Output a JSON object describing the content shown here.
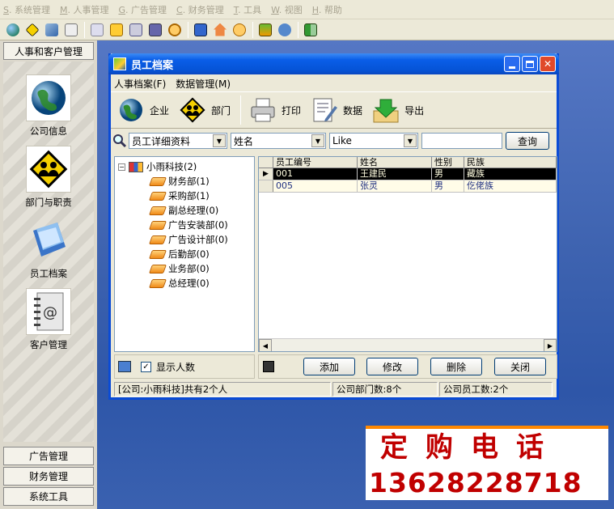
{
  "menubar": [
    {
      "key": "S",
      "label": "系统管理"
    },
    {
      "key": "M",
      "label": "人事管理"
    },
    {
      "key": "G",
      "label": "广告管理"
    },
    {
      "key": "C",
      "label": "财务管理"
    },
    {
      "key": "T",
      "label": "工具"
    },
    {
      "key": "W",
      "label": "视图"
    },
    {
      "key": "H",
      "label": "帮助"
    }
  ],
  "sidebar": {
    "header": "人事和客户管理",
    "items": [
      {
        "label": "公司信息",
        "icon": "globe-icon"
      },
      {
        "label": "部门与职责",
        "icon": "people-sign-icon"
      },
      {
        "label": "员工档案",
        "icon": "documents-icon"
      },
      {
        "label": "客户管理",
        "icon": "address-book-icon"
      }
    ],
    "bottom_buttons": [
      "广告管理",
      "财务管理",
      "系统工具"
    ]
  },
  "ad": {
    "line1": "定购电话",
    "line2": "13628228718"
  },
  "window": {
    "title": "员工档案",
    "menu": [
      "人事档案(F)",
      "数据管理(M)"
    ],
    "tools": [
      {
        "label": "企业",
        "icon": "globe-icon"
      },
      {
        "label": "部门",
        "icon": "people-sign-icon"
      },
      {
        "label": "打印",
        "icon": "printer-icon"
      },
      {
        "label": "数据",
        "icon": "document-pen-icon"
      },
      {
        "label": "导出",
        "icon": "export-icon"
      }
    ],
    "filter": {
      "scope": "员工详细资料",
      "field": "姓名",
      "op": "Like",
      "value": "",
      "query_button": "查询"
    },
    "tree": {
      "root": "小雨科技(2)",
      "children": [
        "财务部(1)",
        "采购部(1)",
        "副总经理(0)",
        "广告安装部(0)",
        "广告设计部(0)",
        "后勤部(0)",
        "业务部(0)",
        "总经理(0)"
      ]
    },
    "grid": {
      "columns": [
        "员工编号",
        "姓名",
        "性别",
        "民族"
      ],
      "rows": [
        [
          "001",
          "王建民",
          "男",
          "藏族"
        ],
        [
          "005",
          "张灵",
          "男",
          "仡佬族"
        ]
      ]
    },
    "show_count_label": "显示人数",
    "show_count_checked": "✓",
    "buttons": {
      "add": "添加",
      "edit": "修改",
      "delete": "删除",
      "close": "关闭"
    },
    "status": [
      "[公司:小雨科技]共有2个人",
      "公司部门数:8个",
      "公司员工数:2个"
    ]
  }
}
